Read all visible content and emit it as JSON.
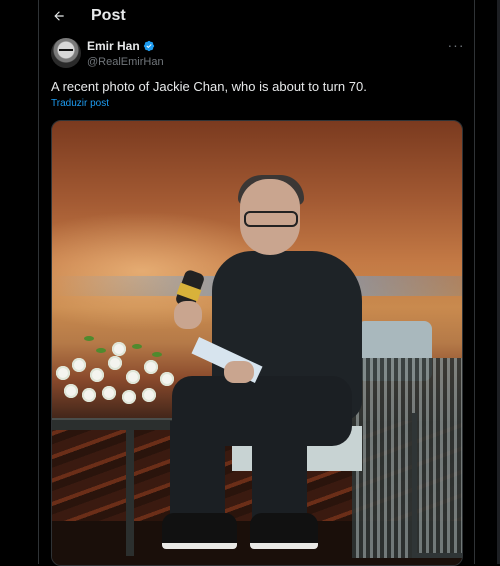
{
  "header": {
    "title": "Post",
    "back_icon": "arrow-left-icon"
  },
  "tweet": {
    "author": {
      "display_name": "Emir Han",
      "handle": "@RealEmirHan",
      "verified": true,
      "verified_color": "#1d9bf0"
    },
    "more_icon": "more-horizontal-icon",
    "text": "A recent photo of Jackie Chan, who is about to turn 70.",
    "translate_label": "Traduzir post",
    "media": {
      "type": "photo",
      "alt": ""
    }
  },
  "colors": {
    "accent": "#1d9bf0",
    "background": "#000000",
    "text": "#e7e9ea",
    "muted": "#71767b"
  }
}
